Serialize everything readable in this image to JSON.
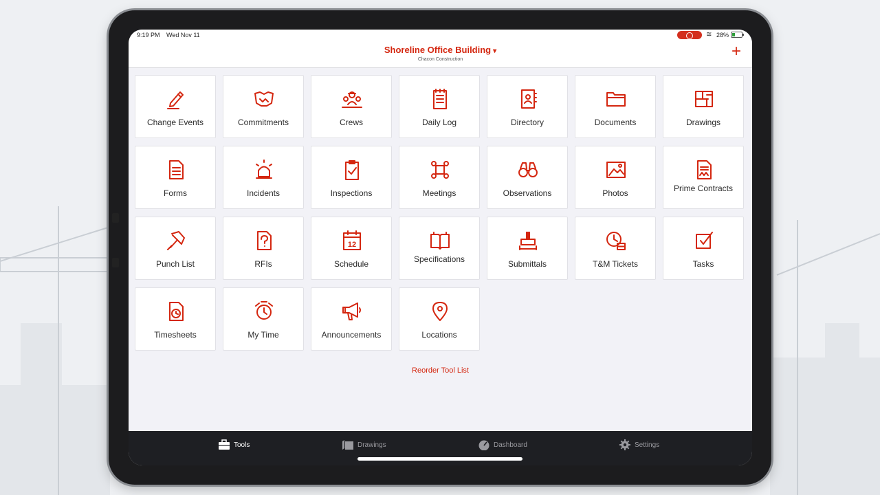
{
  "status_bar": {
    "time": "9:19 PM",
    "date": "Wed Nov 11",
    "battery": "28%"
  },
  "header": {
    "project": "Shoreline Office Building",
    "caret": "▾",
    "company": "Chacon Construction",
    "add": "+"
  },
  "tools": [
    {
      "label": "Change Events",
      "icon": "pencil-icon"
    },
    {
      "label": "Commitments",
      "icon": "handshake-icon"
    },
    {
      "label": "Crews",
      "icon": "crew-icon"
    },
    {
      "label": "Daily Log",
      "icon": "notepad-icon"
    },
    {
      "label": "Directory",
      "icon": "contact-book-icon"
    },
    {
      "label": "Documents",
      "icon": "folder-icon"
    },
    {
      "label": "Drawings",
      "icon": "floorplan-icon"
    },
    {
      "label": "Forms",
      "icon": "form-icon"
    },
    {
      "label": "Incidents",
      "icon": "siren-icon"
    },
    {
      "label": "Inspections",
      "icon": "clipboard-check-icon"
    },
    {
      "label": "Meetings",
      "icon": "meeting-icon"
    },
    {
      "label": "Observations",
      "icon": "binoculars-icon"
    },
    {
      "label": "Photos",
      "icon": "photo-icon"
    },
    {
      "label": "Prime Contracts",
      "icon": "contract-icon"
    },
    {
      "label": "Punch List",
      "icon": "pushpin-icon"
    },
    {
      "label": "RFIs",
      "icon": "question-doc-icon"
    },
    {
      "label": "Schedule",
      "icon": "calendar-icon"
    },
    {
      "label": "Specifications",
      "icon": "book-icon"
    },
    {
      "label": "Submittals",
      "icon": "stamp-icon"
    },
    {
      "label": "T&M Tickets",
      "icon": "clock-ticket-icon"
    },
    {
      "label": "Tasks",
      "icon": "checkbox-icon"
    },
    {
      "label": "Timesheets",
      "icon": "timesheet-icon"
    },
    {
      "label": "My Time",
      "icon": "alarm-clock-icon"
    },
    {
      "label": "Announcements",
      "icon": "megaphone-icon"
    },
    {
      "label": "Locations",
      "icon": "map-pin-icon"
    }
  ],
  "reorder_label": "Reorder Tool List",
  "tabs": [
    {
      "label": "Tools",
      "icon": "toolbox-icon",
      "active": true
    },
    {
      "label": "Drawings",
      "icon": "blueprint-icon",
      "active": false
    },
    {
      "label": "Dashboard",
      "icon": "gauge-icon",
      "active": false
    },
    {
      "label": "Settings",
      "icon": "gear-icon",
      "active": false
    }
  ],
  "colors": {
    "accent": "#d4260f",
    "tabbar": "#1e1f23",
    "screen_bg": "#f2f2f7"
  }
}
